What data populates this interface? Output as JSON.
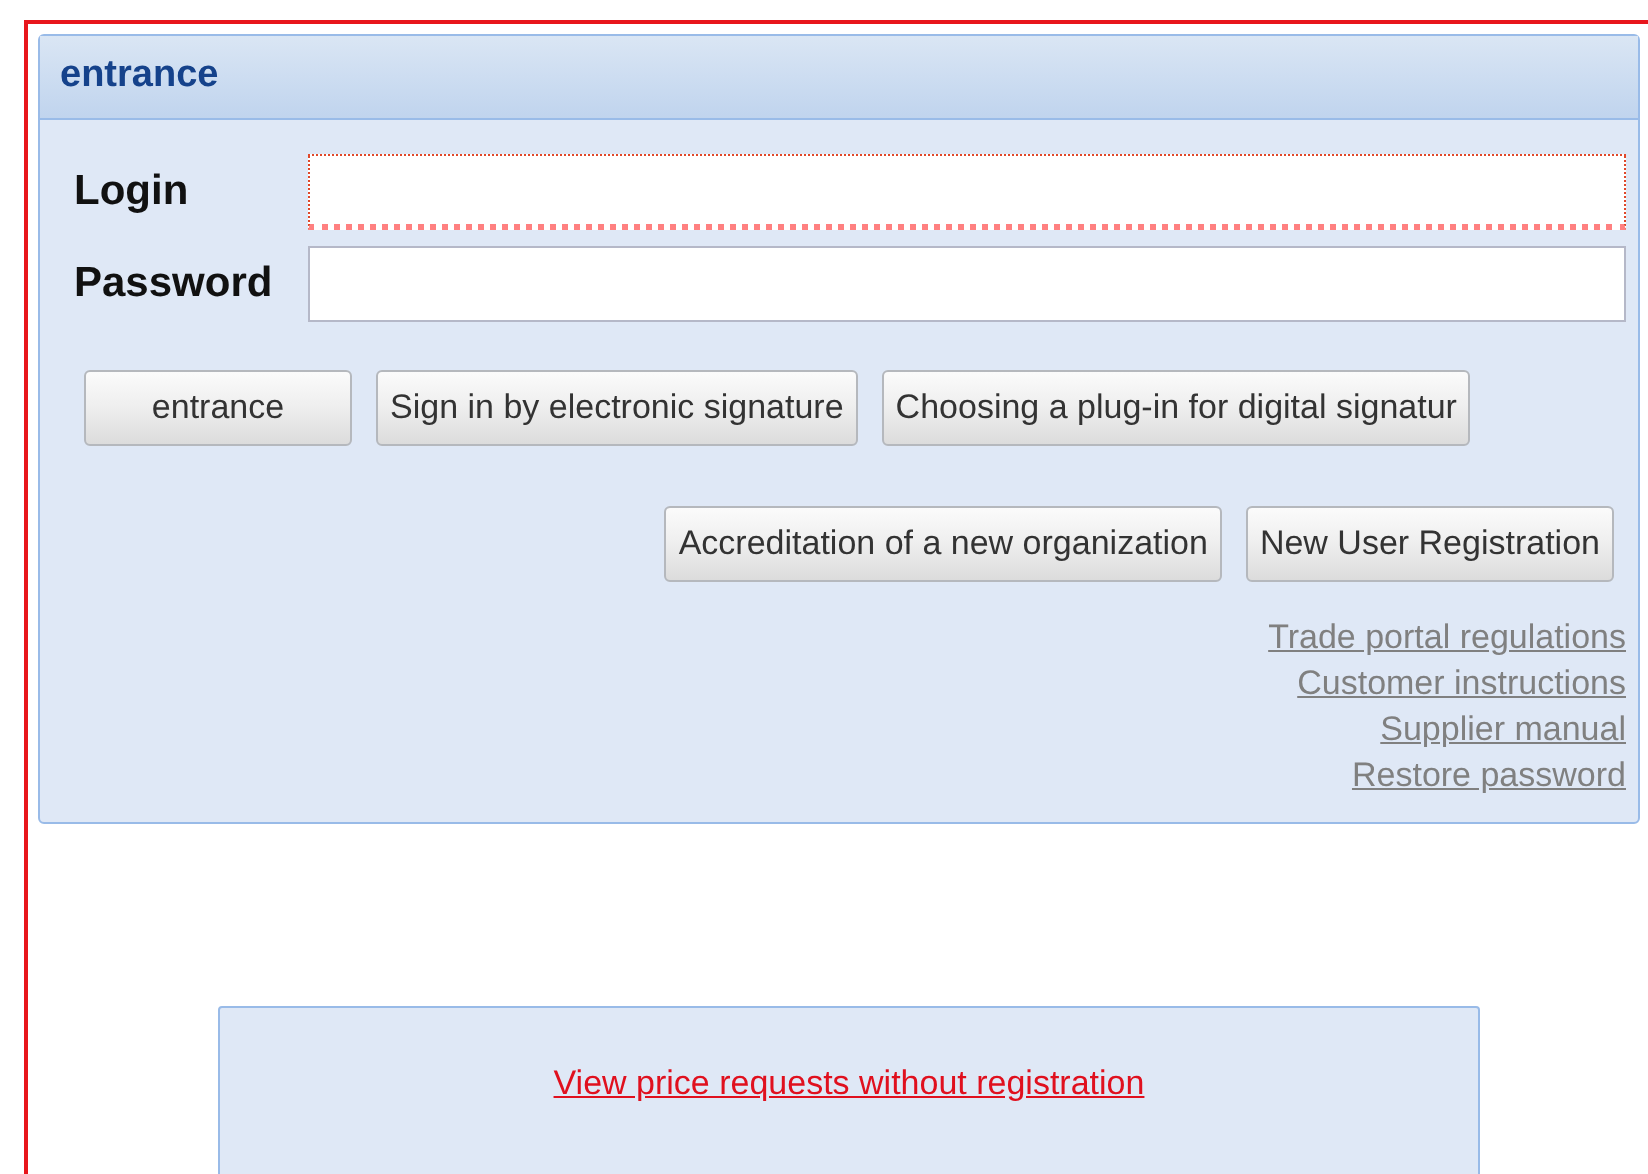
{
  "panel": {
    "title": "entrance"
  },
  "fields": [
    {
      "label": "Login",
      "invalid": true
    },
    {
      "label": "Password",
      "invalid": false
    }
  ],
  "buttons": [
    "entrance",
    "Sign in by electronic signature",
    "Choosing a plug-in for digital signatur"
  ],
  "secondary_buttons": [
    "Accreditation of a new organization",
    "New User Registration"
  ],
  "links": [
    "Trade portal regulations",
    "Customer instructions",
    "Supplier manual",
    "Restore password"
  ],
  "guest_link": "View price requests without registration"
}
